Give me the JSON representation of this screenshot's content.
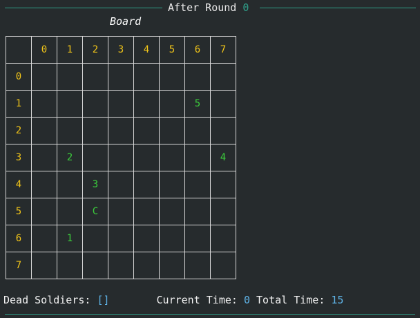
{
  "header": {
    "title_prefix": "After Round ",
    "round": "0"
  },
  "board": {
    "caption": "Board",
    "column_headers": [
      "0",
      "1",
      "2",
      "3",
      "4",
      "5",
      "6",
      "7"
    ],
    "rows": [
      {
        "label": "0",
        "cells": [
          "",
          "",
          "",
          "",
          "",
          "",
          "",
          ""
        ]
      },
      {
        "label": "1",
        "cells": [
          "",
          "",
          "",
          "",
          "",
          "",
          "5",
          ""
        ]
      },
      {
        "label": "2",
        "cells": [
          "",
          "",
          "",
          "",
          "",
          "",
          "",
          ""
        ]
      },
      {
        "label": "3",
        "cells": [
          "",
          "2",
          "",
          "",
          "",
          "",
          "",
          "4"
        ]
      },
      {
        "label": "4",
        "cells": [
          "",
          "",
          "3",
          "",
          "",
          "",
          "",
          ""
        ]
      },
      {
        "label": "5",
        "cells": [
          "",
          "",
          "C",
          "",
          "",
          "",
          "",
          ""
        ]
      },
      {
        "label": "6",
        "cells": [
          "",
          "1",
          "",
          "",
          "",
          "",
          "",
          ""
        ]
      },
      {
        "label": "7",
        "cells": [
          "",
          "",
          "",
          "",
          "",
          "",
          "",
          ""
        ]
      }
    ]
  },
  "footer": {
    "dead_label": "Dead Soldiers: ",
    "dead_value": "[]",
    "current_label": "Current Time: ",
    "current_value": "0",
    "total_label": " Total Time: ",
    "total_value": "15"
  },
  "colors": {
    "background": "#262b2d",
    "rule": "#2fa08a",
    "header_numbers": "#f0c419",
    "pieces": "#3ccf3c",
    "values": "#5fb4e8"
  }
}
